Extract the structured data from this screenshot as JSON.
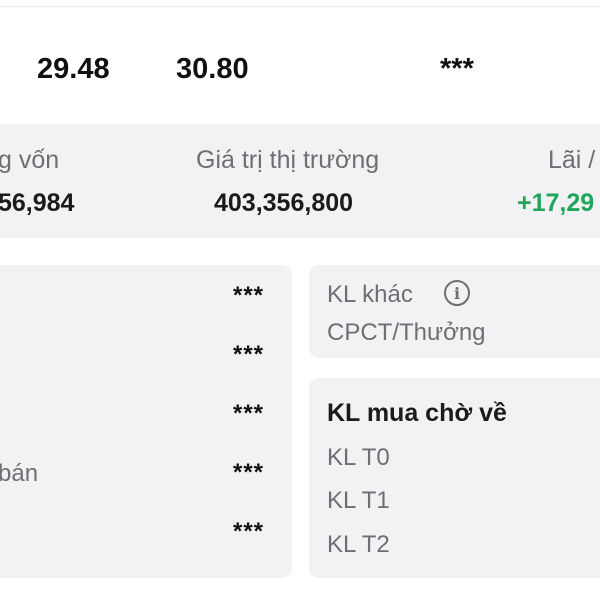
{
  "top_row": {
    "value_1": "29.48",
    "value_2": "30.80",
    "value_3": "***"
  },
  "summary": {
    "col1_label": "g vốn",
    "col1_value": "56,984",
    "col2_label": "Giá trị thị trường",
    "col2_value": "403,356,800",
    "col3_label": "Lãi /",
    "col3_value": "+17,29"
  },
  "left_card": {
    "rows": [
      {
        "label": "",
        "value": "***"
      },
      {
        "label": "",
        "value": "***"
      },
      {
        "label": "",
        "value": "***"
      },
      {
        "label": "bán",
        "value": "***"
      },
      {
        "label": "",
        "value": "***"
      }
    ]
  },
  "other_card": {
    "title": "KL khác",
    "icon": "info-icon",
    "subtitle": "CPCT/Thưởng"
  },
  "pending_card": {
    "title": "KL mua chờ về",
    "items": [
      "KL T0",
      "KL T1",
      "KL T2"
    ]
  },
  "colors": {
    "positive": "#20a55a",
    "card_bg": "#f2f2f4",
    "muted_text": "#6f6f73"
  }
}
